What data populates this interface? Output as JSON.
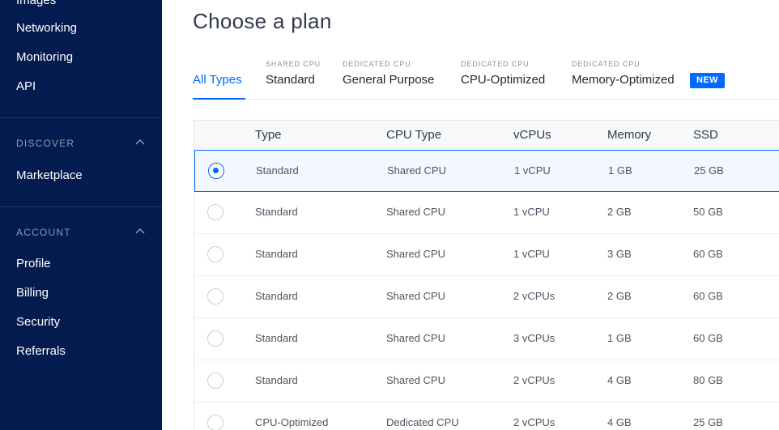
{
  "sidebar": {
    "top_items": [
      "Images",
      "Networking",
      "Monitoring",
      "API"
    ],
    "sections": [
      {
        "title": "DISCOVER",
        "items": [
          "Marketplace"
        ]
      },
      {
        "title": "ACCOUNT",
        "items": [
          "Profile",
          "Billing",
          "Security",
          "Referrals"
        ]
      }
    ]
  },
  "main": {
    "title": "Choose a plan",
    "tabs": [
      {
        "sup": "",
        "label": "All Types",
        "active": true
      },
      {
        "sup": "SHARED CPU",
        "label": "Standard"
      },
      {
        "sup": "DEDICATED CPU",
        "label": "General Purpose"
      },
      {
        "sup": "DEDICATED CPU",
        "label": "CPU-Optimized"
      },
      {
        "sup": "DEDICATED CPU",
        "label": "Memory-Optimized"
      }
    ],
    "new_badge": "NEW",
    "table": {
      "headers": [
        "Type",
        "CPU Type",
        "vCPUs",
        "Memory",
        "SSD"
      ],
      "rows": [
        {
          "selected": true,
          "cells": [
            "Standard",
            "Shared CPU",
            "1 vCPU",
            "1 GB",
            "25 GB"
          ]
        },
        {
          "selected": false,
          "cells": [
            "Standard",
            "Shared CPU",
            "1 vCPU",
            "2 GB",
            "50 GB"
          ]
        },
        {
          "selected": false,
          "cells": [
            "Standard",
            "Shared CPU",
            "1 vCPU",
            "3 GB",
            "60 GB"
          ]
        },
        {
          "selected": false,
          "cells": [
            "Standard",
            "Shared CPU",
            "2 vCPUs",
            "2 GB",
            "60 GB"
          ]
        },
        {
          "selected": false,
          "cells": [
            "Standard",
            "Shared CPU",
            "3 vCPUs",
            "1 GB",
            "60 GB"
          ]
        },
        {
          "selected": false,
          "cells": [
            "Standard",
            "Shared CPU",
            "2 vCPUs",
            "4 GB",
            "80 GB"
          ]
        },
        {
          "selected": false,
          "cells": [
            "CPU-Optimized",
            "Dedicated CPU",
            "2 vCPUs",
            "4 GB",
            "25 GB"
          ]
        }
      ]
    }
  },
  "colors": {
    "sidebar_bg": "#031b4e",
    "accent": "#0069ff"
  }
}
